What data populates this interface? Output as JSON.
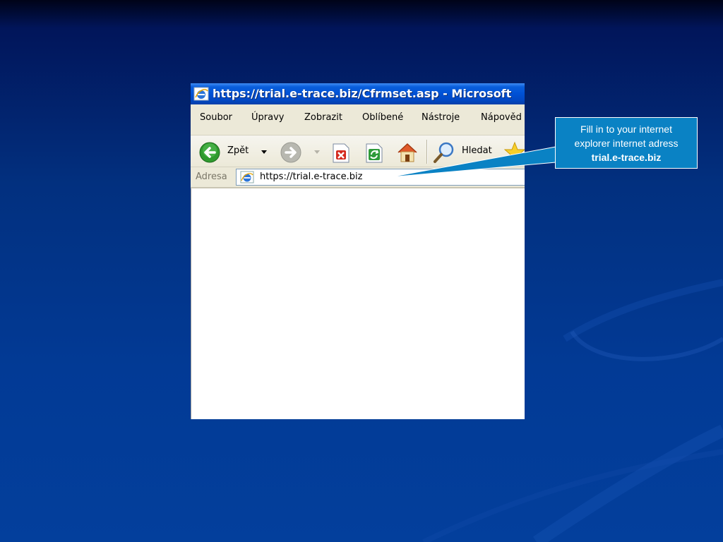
{
  "browser": {
    "title": "https://trial.e-trace.biz/Cfrmset.asp - Microsoft",
    "menu": [
      "Soubor",
      "Úpravy",
      "Zobrazit",
      "Oblíbené",
      "Nástroje",
      "Nápověd"
    ],
    "toolbar": {
      "back_label": "Zpět",
      "search_label": "Hledat",
      "icons": [
        "back-arrow-icon",
        "dropdown-arrow-icon",
        "forward-arrow-icon",
        "stop-icon",
        "refresh-icon",
        "home-icon",
        "search-icon",
        "favorites-star-icon"
      ]
    },
    "address": {
      "label": "Adresa",
      "url": "https://trial.e-trace.biz"
    }
  },
  "callout": {
    "line1": "Fill in to your internet",
    "line2": "explorer internet adress",
    "line3": "trial.e-trace.biz"
  },
  "colors": {
    "background_top": "#000318",
    "background_bottom": "#033f9c",
    "titlebar_blue": "#0052d6",
    "callout_fill": "#0a82c4",
    "chrome": "#ece9d8"
  }
}
